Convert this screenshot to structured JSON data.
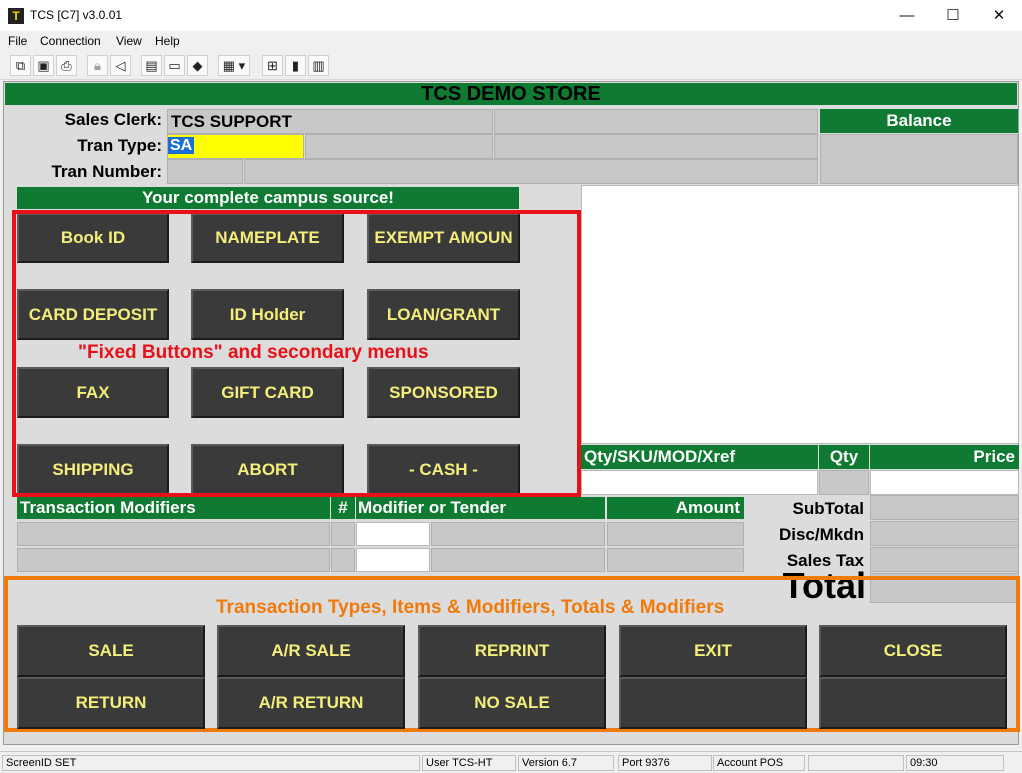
{
  "window": {
    "title": "TCS [C7]  v3.0.01",
    "app_icon": "T",
    "min": "—",
    "max": "☐",
    "close": "✕"
  },
  "menu": [
    "File",
    "Connection",
    "View",
    "Help"
  ],
  "toolbar_icons": [
    "copy-icon",
    "save-icon",
    "print-icon",
    "lock-icon",
    "sound-icon",
    "settings-icon",
    "monitor-icon",
    "book-icon",
    "clipboard-icon",
    "tree-icon",
    "chart-icon",
    "calculator-icon"
  ],
  "store": {
    "name": "TCS DEMO STORE"
  },
  "header": {
    "sales_clerk_label": "Sales Clerk:",
    "sales_clerk_value": "TCS SUPPORT",
    "tran_type_label": "Tran Type:",
    "tran_type_value": "SA",
    "tran_number_label": "Tran Number:",
    "balance_label": "Balance"
  },
  "banner": "Your complete campus source!",
  "fixed_buttons": {
    "annotation": "\"Fixed Buttons\" and secondary menus",
    "rows": [
      [
        "Book ID",
        "NAMEPLATE",
        "EXEMPT AMOUN"
      ],
      [
        "CARD DEPOSIT",
        "ID Holder",
        "LOAN/GRANT"
      ],
      [
        "FAX",
        "GIFT CARD",
        "SPONSORED"
      ],
      [
        "SHIPPING",
        "ABORT",
        "- CASH -"
      ]
    ]
  },
  "item_entry": {
    "sku_label": "Qty/SKU/MOD/Xref",
    "qty_label": "Qty",
    "price_label": "Price"
  },
  "modifiers": {
    "col_transaction": "Transaction Modifiers",
    "col_num": "#",
    "col_tender": "Modifier or Tender",
    "col_amount": "Amount"
  },
  "totals": {
    "subtotal": "SubTotal",
    "disc": "Disc/Mkdn",
    "tax": "Sales Tax",
    "total": "Total"
  },
  "bottom": {
    "annotation": "Transaction Types, Items & Modifiers, Totals & Modifiers",
    "row1": [
      "SALE",
      "A/R SALE",
      "REPRINT",
      "EXIT",
      "CLOSE"
    ],
    "row2": [
      "RETURN",
      "A/R RETURN",
      "NO SALE",
      "",
      ""
    ]
  },
  "status": {
    "screen": "ScreenID SET",
    "user": "User TCS-HT",
    "version": "Version 6.7",
    "port": "Port 9376",
    "account": "Account POS",
    "time": "09:30"
  },
  "colors": {
    "green": "#0f7a32",
    "button": "#3a3a3a",
    "button_text": "#f4ee7a",
    "red_box": "#e8111a",
    "orange_box": "#f07a0a",
    "highlight": "#ffff00"
  }
}
